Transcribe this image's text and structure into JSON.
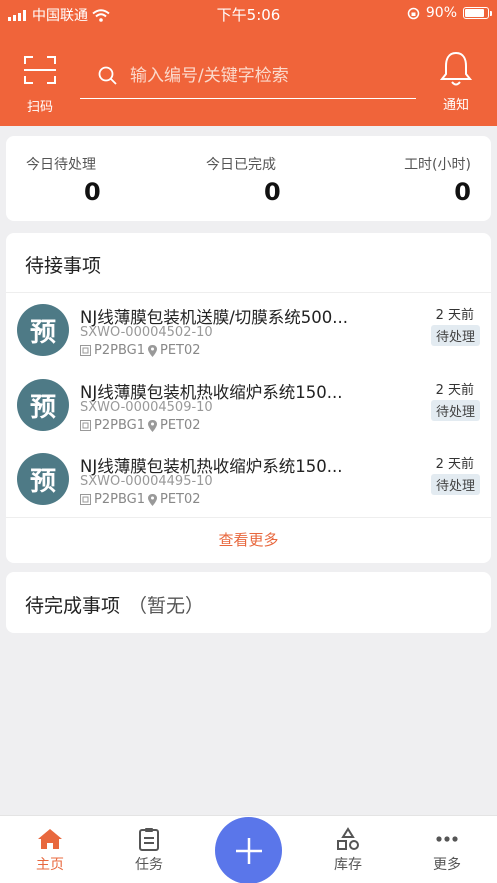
{
  "status_bar": {
    "carrier": "中国联通",
    "time": "下午5:06",
    "battery": "90%"
  },
  "header": {
    "scan_label": "扫码",
    "search_placeholder": "输入编号/关键字检索",
    "notify_label": "通知"
  },
  "stats": [
    {
      "label": "今日待处理",
      "value": "0"
    },
    {
      "label": "今日已完成",
      "value": "0"
    },
    {
      "label": "工时(小时)",
      "value": "0"
    }
  ],
  "pending": {
    "title": "待接事项",
    "items": [
      {
        "avatar": "预",
        "title": "NJ线薄膜包装机送膜/切膜系统500...",
        "code": "SXWO-00004502-10",
        "location": "P2PBG1",
        "site": "PET02",
        "time": "2 天前",
        "status": "待处理"
      },
      {
        "avatar": "预",
        "title": "NJ线薄膜包装机热收缩炉系统150...",
        "code": "SXWO-00004509-10",
        "location": "P2PBG1",
        "site": "PET02",
        "time": "2 天前",
        "status": "待处理"
      },
      {
        "avatar": "预",
        "title": "NJ线薄膜包装机热收缩炉系统150...",
        "code": "SXWO-00004495-10",
        "location": "P2PBG1",
        "site": "PET02",
        "time": "2 天前",
        "status": "待处理"
      }
    ],
    "more_label": "查看更多"
  },
  "todo": {
    "title": "待完成事项",
    "none_label": "（暂无）"
  },
  "tabs": [
    {
      "label": "主页",
      "icon": "home-icon"
    },
    {
      "label": "任务",
      "icon": "task-icon"
    },
    {
      "label": "库存",
      "icon": "inventory-icon"
    },
    {
      "label": "更多",
      "icon": "more-icon"
    }
  ],
  "colors": {
    "brand": "#f0643a",
    "accent": "#e8683e",
    "fab": "#5a76ea",
    "avatar": "#4e7a86"
  }
}
